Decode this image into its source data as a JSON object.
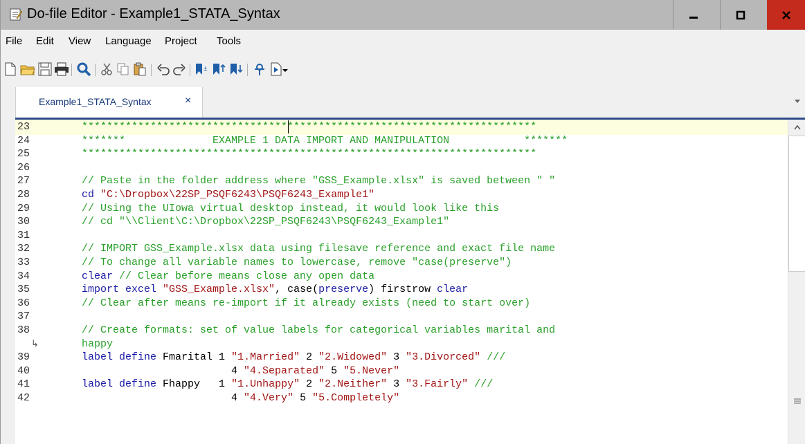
{
  "window": {
    "title": "Do-file Editor - Example1_STATA_Syntax",
    "controls": {
      "minimize": "minimize",
      "maximize": "maximize",
      "close": "close"
    }
  },
  "menu": {
    "items": [
      "File",
      "Edit",
      "View",
      "Language",
      "Project",
      "Tools"
    ]
  },
  "toolbar": {
    "buttons": [
      "new-file-icon",
      "open-folder-icon",
      "save-icon",
      "print-icon",
      "find-icon",
      "cut-icon",
      "copy-icon",
      "paste-icon",
      "undo-icon",
      "redo-icon",
      "toggle-bookmark-icon",
      "previous-bookmark-icon",
      "next-bookmark-icon",
      "show-file-icon",
      "execute-icon",
      "execute-dropdown-icon"
    ]
  },
  "tabs": [
    {
      "label": "Example1_STATA_Syntax",
      "close": "×"
    }
  ],
  "editor": {
    "lines": [
      {
        "n": "23",
        "segs": [
          [
            "com",
            "*************************************************************************"
          ]
        ]
      },
      {
        "n": "24",
        "segs": [
          [
            "com",
            "*******              EXAMPLE 1 DATA IMPORT AND MANIPULATION            *******"
          ]
        ]
      },
      {
        "n": "25",
        "segs": [
          [
            "com",
            "*************************************************************************"
          ]
        ]
      },
      {
        "n": "26",
        "segs": []
      },
      {
        "n": "27",
        "segs": [
          [
            "com",
            "// Paste in the folder address where \"GSS_Example.xlsx\" is saved between \" \""
          ]
        ]
      },
      {
        "n": "28",
        "segs": [
          [
            "kw",
            "cd "
          ],
          [
            "str",
            "\"C:\\Dropbox\\22SP_PSQF6243\\PSQF6243_Example1\""
          ]
        ]
      },
      {
        "n": "29",
        "segs": [
          [
            "com",
            "// Using the UIowa virtual desktop instead, it would look like this"
          ]
        ]
      },
      {
        "n": "30",
        "segs": [
          [
            "com",
            "// cd \"\\\\Client\\C:\\Dropbox\\22SP_PSQF6243\\PSQF6243_Example1\""
          ]
        ]
      },
      {
        "n": "31",
        "segs": []
      },
      {
        "n": "32",
        "segs": [
          [
            "com",
            "// IMPORT GSS_Example.xlsx data using filesave reference and exact file name"
          ]
        ]
      },
      {
        "n": "33",
        "segs": [
          [
            "com",
            "// To change all variable names to lowercase, remove \"case(preserve\")"
          ]
        ]
      },
      {
        "n": "34",
        "segs": [
          [
            "kw",
            "clear "
          ],
          [
            "com",
            "// Clear before means close any open data"
          ]
        ]
      },
      {
        "n": "35",
        "segs": [
          [
            "kw",
            "import excel "
          ],
          [
            "str",
            "\"GSS_Example.xlsx\""
          ],
          [
            "plain",
            ", case("
          ],
          [
            "kw",
            "preserve"
          ],
          [
            "plain",
            ") firstrow "
          ],
          [
            "kw",
            "clear"
          ]
        ]
      },
      {
        "n": "36",
        "segs": [
          [
            "com",
            "// Clear after means re-import if it already exists (need to start over)"
          ]
        ]
      },
      {
        "n": "37",
        "segs": []
      },
      {
        "n": "38",
        "segs": [
          [
            "com",
            "// Create formats: set of value labels for categorical variables marital and"
          ]
        ]
      },
      {
        "n": "",
        "wrap": "↳",
        "segs": [
          [
            "com",
            "happy"
          ]
        ]
      },
      {
        "n": "39",
        "segs": [
          [
            "kw",
            "label define "
          ],
          [
            "plain",
            "Fmarital 1 "
          ],
          [
            "str",
            "\"1.Married\""
          ],
          [
            "plain",
            " 2 "
          ],
          [
            "str",
            "\"2.Widowed\""
          ],
          [
            "plain",
            " 3 "
          ],
          [
            "str",
            "\"3.Divorced\""
          ],
          [
            "plain",
            " "
          ],
          [
            "com",
            "///"
          ]
        ]
      },
      {
        "n": "40",
        "segs": [
          [
            "plain",
            "                        4 "
          ],
          [
            "str",
            "\"4.Separated\""
          ],
          [
            "plain",
            " 5 "
          ],
          [
            "str",
            "\"5.Never\""
          ]
        ]
      },
      {
        "n": "41",
        "segs": [
          [
            "kw",
            "label define "
          ],
          [
            "plain",
            "Fhappy   1 "
          ],
          [
            "str",
            "\"1.Unhappy\""
          ],
          [
            "plain",
            " 2 "
          ],
          [
            "str",
            "\"2.Neither\""
          ],
          [
            "plain",
            " 3 "
          ],
          [
            "str",
            "\"3.Fairly\""
          ],
          [
            "plain",
            " "
          ],
          [
            "com",
            "///"
          ]
        ]
      },
      {
        "n": "42",
        "segs": [
          [
            "plain",
            "                        4 "
          ],
          [
            "str",
            "\"4.Very\""
          ],
          [
            "plain",
            " 5 "
          ],
          [
            "str",
            "\"5.Completely\""
          ]
        ]
      }
    ]
  }
}
